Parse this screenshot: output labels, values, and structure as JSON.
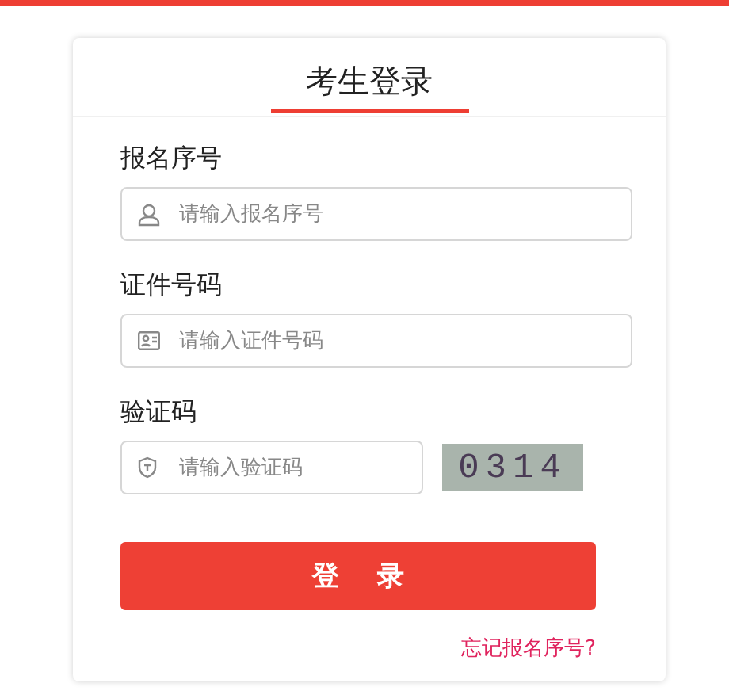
{
  "title": "考生登录",
  "fields": [
    {
      "label": "报名序号",
      "placeholder": "请输入报名序号",
      "kind": "user"
    },
    {
      "label": "证件号码",
      "placeholder": "请输入证件号码",
      "kind": "id"
    },
    {
      "label": "验证码",
      "placeholder": "请输入验证码",
      "kind": "captcha",
      "captcha": "0314"
    }
  ],
  "login_button": "登 录",
  "forgot_link": "忘记报名序号?"
}
